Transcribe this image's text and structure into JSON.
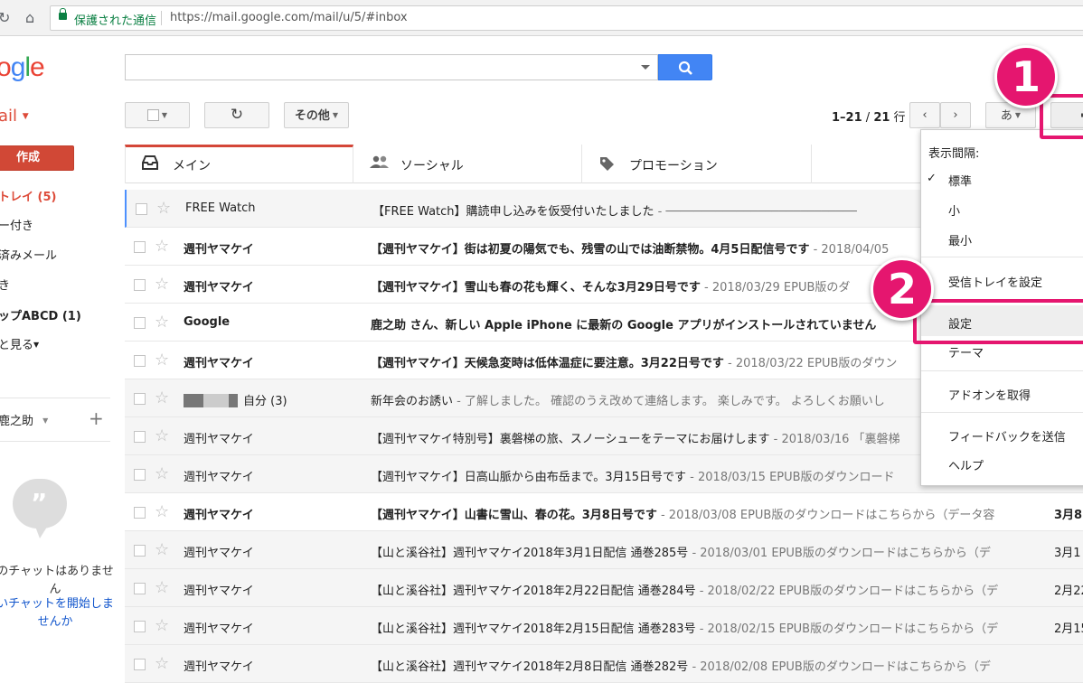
{
  "browser": {
    "secure_label": "保護された通信",
    "url": "https://mail.google.com/mail/u/5/#inbox",
    "back_icon": "arrow-left-icon",
    "forward_icon": "arrow-right-icon",
    "reload_icon": "reload-icon",
    "home_icon": "home-icon"
  },
  "header": {
    "logo_letters": [
      "o",
      "g",
      "l",
      "e"
    ],
    "search_value": "",
    "search_icon": "search-icon"
  },
  "toolbar": {
    "mail_label": "ail",
    "more_label": "その他",
    "page_range": "1–21",
    "page_of": "/",
    "page_total": "21",
    "page_unit": "行",
    "input_tool_label": "あ"
  },
  "sidebar": {
    "compose_label": "作成",
    "items": [
      {
        "label": "トレイ (5)"
      },
      {
        "label": "ー付き"
      },
      {
        "label": "済みメール"
      },
      {
        "label": "き"
      },
      {
        "label": "ップABCD (1)"
      },
      {
        "label": "と見る"
      }
    ],
    "hangouts_user": "鹿之助",
    "no_chat": "のチャットはありませ ん",
    "start_chat": "いチャットを開始しま せんか"
  },
  "tabs": [
    {
      "label": "メイン",
      "icon": "inbox-icon"
    },
    {
      "label": "ソーシャル",
      "icon": "people-icon"
    },
    {
      "label": "プロモーション",
      "icon": "tag-icon"
    }
  ],
  "emails": [
    {
      "sender": "FREE Watch",
      "subject": "【FREE Watch】購読申し込みを仮受付いたしました",
      "snippet": " - ───────────────────────────",
      "date": "",
      "unread": false
    },
    {
      "sender": "週刊ヤマケイ",
      "subject": "【週刊ヤマケイ】街は初夏の陽気でも、残雪の山では油断禁物。4月5日配信号です",
      "snippet": " - 2018/04/05",
      "date": "",
      "unread": true
    },
    {
      "sender": "週刊ヤマケイ",
      "subject": "【週刊ヤマケイ】雪山も春の花も輝く、そんな3月29日号です",
      "snippet": " - 2018/03/29 EPUB版のダ",
      "date": "",
      "unread": true
    },
    {
      "sender": "Google",
      "subject": "鹿之助 さん、新しい Apple iPhone に最新の Google アプリがインストールされていません",
      "snippet": "",
      "date": "",
      "unread": true
    },
    {
      "sender": "週刊ヤマケイ",
      "subject": "【週刊ヤマケイ】天候急変時は低体温症に要注意。3月22日号です",
      "snippet": " - 2018/03/22 EPUB版のダウン",
      "date": "",
      "unread": true
    },
    {
      "sender": "自分 (3)",
      "subject": "新年会のお誘い",
      "snippet": " - 了解しました。 確認のうえ改めて連絡します。 楽しみです。 よろしくお願いし",
      "date": "",
      "unread": false,
      "redacted": true
    },
    {
      "sender": "週刊ヤマケイ",
      "subject": "【週刊ヤマケイ特別号】裏磐梯の旅、スノーシューをテーマにお届けします",
      "snippet": " - 2018/03/16 「裏磐梯",
      "date": "",
      "unread": false
    },
    {
      "sender": "週刊ヤマケイ",
      "subject": "【週刊ヤマケイ】日高山脈から由布岳まで。3月15日号です",
      "snippet": " - 2018/03/15 EPUB版のダウンロード",
      "date": "",
      "unread": false
    },
    {
      "sender": "週刊ヤマケイ",
      "subject": "【週刊ヤマケイ】山書に雪山、春の花。3月8日号です",
      "snippet": " - 2018/03/08 EPUB版のダウンロードはこちらから（データ容",
      "date": "3月8",
      "unread": true
    },
    {
      "sender": "週刊ヤマケイ",
      "subject": "【山と溪谷社】週刊ヤマケイ2018年3月1日配信 通巻285号",
      "snippet": " - 2018/03/01 EPUB版のダウンロードはこちらから（デ",
      "date": "3月1",
      "unread": false
    },
    {
      "sender": "週刊ヤマケイ",
      "subject": "【山と溪谷社】週刊ヤマケイ2018年2月22日配信 通巻284号",
      "snippet": " - 2018/02/22 EPUB版のダウンロードはこちらから（デ",
      "date": "2月22",
      "unread": false
    },
    {
      "sender": "週刊ヤマケイ",
      "subject": "【山と溪谷社】週刊ヤマケイ2018年2月15日配信 通巻283号",
      "snippet": " - 2018/02/15 EPUB版のダウンロードはこちらから（デ",
      "date": "2月15",
      "unread": false
    },
    {
      "sender": "週刊ヤマケイ",
      "subject": "【山と溪谷社】週刊ヤマケイ2018年2月8日配信 通巻282号",
      "snippet": " - 2018/02/08 EPUB版のダウンロードはこちらから（デ",
      "date": "",
      "unread": false
    }
  ],
  "settings_menu": {
    "density_header": "表示間隔:",
    "density_options": [
      "標準",
      "小",
      "最小"
    ],
    "selected_density": "標準",
    "configure_inbox": "受信トレイを設定",
    "settings": "設定",
    "themes": "テーマ",
    "get_addons": "アドオンを取得",
    "send_feedback": "フィードバックを送信",
    "help": "ヘルプ"
  },
  "annotations": [
    "1",
    "2"
  ],
  "colors": {
    "accent_red": "#dd4b39",
    "compose_red": "#d14836",
    "search_blue": "#4285f4",
    "callout_pink": "#e5166f",
    "secure_green": "#0b8043"
  }
}
